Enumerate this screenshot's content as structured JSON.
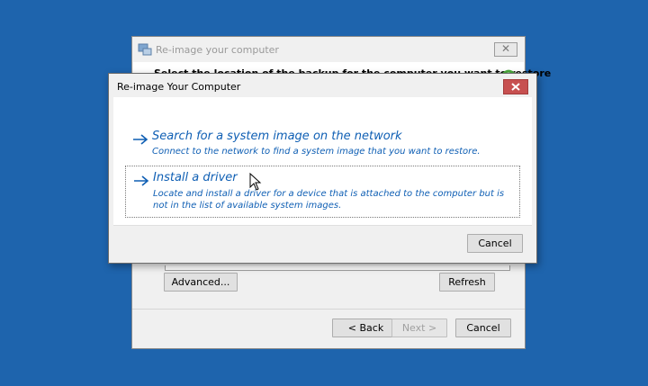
{
  "background_window": {
    "title": "Re-image your computer",
    "heading": "Select the location of the backup for the computer you want to restore",
    "close_symbol": "✕",
    "buttons": {
      "advanced": "Advanced...",
      "refresh": "Refresh",
      "back": "< Back",
      "next": "Next >",
      "cancel": "Cancel"
    }
  },
  "dialog": {
    "title": "Re-image Your Computer",
    "options": [
      {
        "title": "Search for a system image on the network",
        "description": "Connect to the network to find a system image that you want to restore."
      },
      {
        "title": "Install a driver",
        "description": "Locate and install a driver for a device that is attached to the computer but is not in the list of available system images."
      }
    ],
    "cancel": "Cancel"
  },
  "colors": {
    "desktop": "#1e64ad",
    "link_blue": "#0f5fb4",
    "close_red": "#c75050"
  },
  "icons": [
    "window-app-icon",
    "restore-icon",
    "close-icon",
    "arrow-right-icon",
    "mouse-cursor-icon"
  ]
}
